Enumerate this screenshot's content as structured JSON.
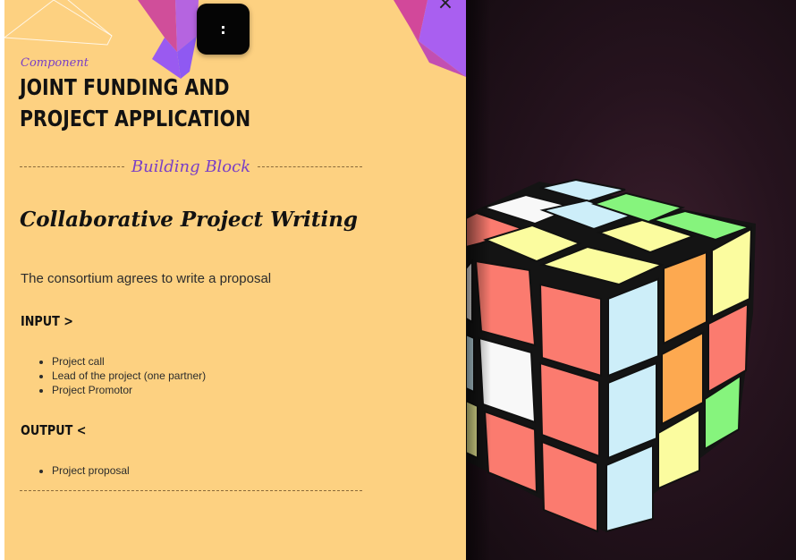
{
  "header": {
    "menu_label": ":",
    "close_label": "×"
  },
  "component": {
    "kicker": "Component",
    "title": "JOINT FUNDING AND PROJECT APPLICATION"
  },
  "building_block": {
    "label": "Building Block"
  },
  "block": {
    "heading": "Collaborative Project Writing",
    "summary": "The consortium agrees to write a proposal"
  },
  "input": {
    "label": "INPUT >",
    "items": [
      "Project call",
      "Lead of the project (one partner)",
      "Project Promotor"
    ]
  },
  "output": {
    "label": "OUTPUT <",
    "items": [
      "Project proposal"
    ]
  },
  "colors": {
    "panel_background": "#fdd181",
    "accent_purple": "#7a3fc6",
    "cube_red": "#fb7b6f",
    "cube_yellow": "#fbfc9f",
    "cube_orange": "#fda950",
    "cube_green": "#86f47d",
    "cube_blue": "#cdeef9",
    "cube_white": "#f8f8f8"
  },
  "scene": {
    "object": "rubiks-cube"
  }
}
